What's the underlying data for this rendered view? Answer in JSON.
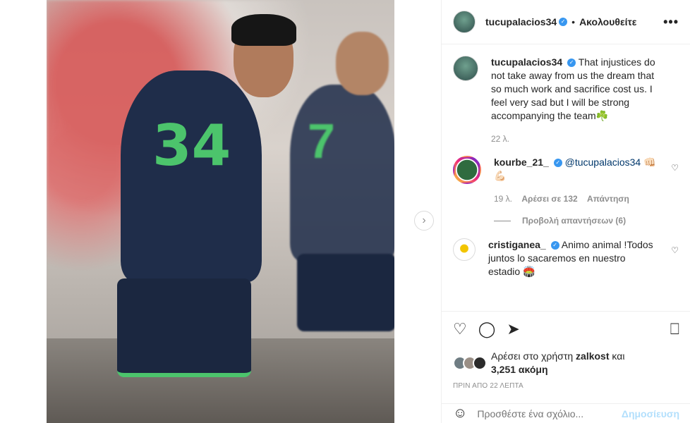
{
  "header": {
    "username": "tucupalacios34",
    "separator": "•",
    "follow_label": "Ακολουθείτε",
    "more_label": "•••"
  },
  "media": {
    "next_label": "›"
  },
  "caption": {
    "username": "tucupalacios34",
    "text": "That injustices do not take away from us the dream that so much work and sacrifice cost us. I feel very sad but I will be strong accompanying the team☘️",
    "time": "22 λ."
  },
  "comments": [
    {
      "username": "kourbe_21_",
      "mention": "@tucupalacios34",
      "text": "👊🏻💪🏻",
      "time": "19 λ.",
      "likes": "Αρέσει σε 132",
      "reply": "Απάντηση"
    },
    {
      "username": "cristiganea_",
      "text": "Animo animal !Todos juntos lo sacaremos en nuestro estadio 🏟️"
    }
  ],
  "view_replies": "Προβολή απαντήσεων (6)",
  "actions": {
    "like_icon": "♡",
    "comment_icon": "◯",
    "share_icon": "➤",
    "save_icon": "⎕"
  },
  "likes": {
    "prefix": "Αρέσει στο χρήστη",
    "user": "zalkost",
    "suffix": "και",
    "others": "3,251 ακόμη"
  },
  "time_ago": "ΠΡΙΝ ΑΠΟ 22 ΛΕΠΤΑ",
  "add_comment": {
    "placeholder": "Προσθέστε ένα σχόλιο...",
    "post_label": "Δημοσίευση"
  },
  "colors": {
    "verified": "#3897f0",
    "kit_green": "#4cc46c",
    "kit_navy": "#1f2d4a"
  }
}
